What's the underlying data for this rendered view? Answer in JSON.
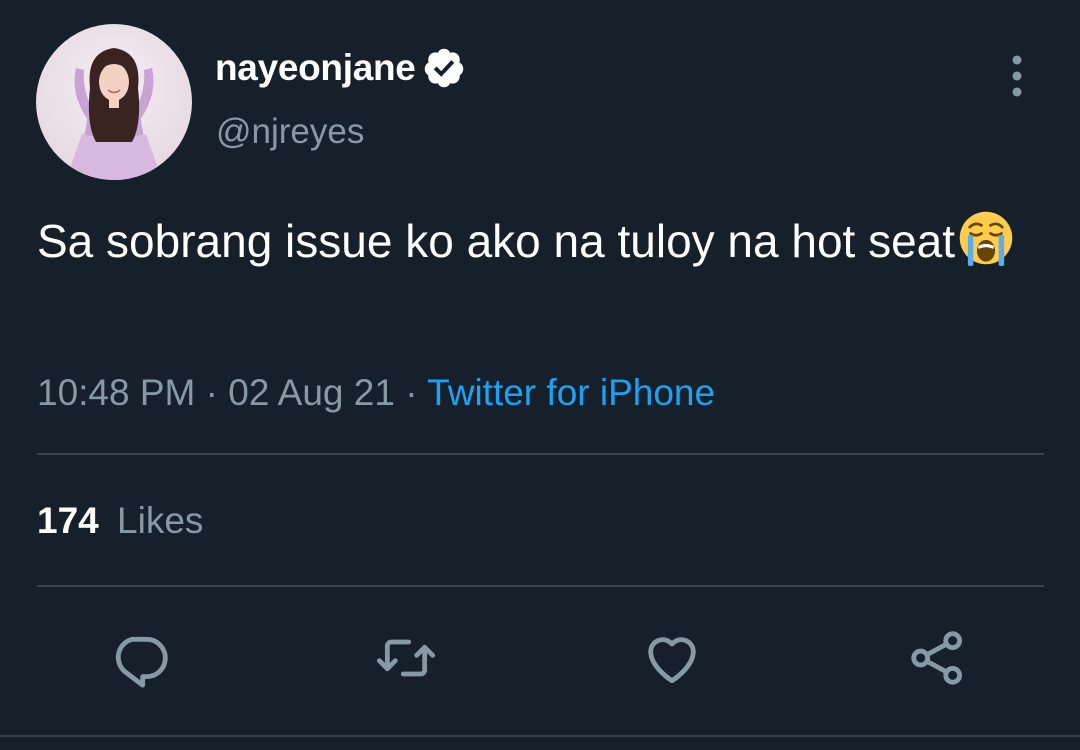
{
  "tweet": {
    "display_name": "nayeonjane",
    "handle": "@njreyes",
    "text": "Sa sobrang issue ko ako na tuloy na hot seat",
    "emoji": "loudly-crying-face",
    "time": "10:48 PM",
    "date": "02 Aug 21",
    "separator": "·",
    "source": "Twitter for iPhone",
    "likes_count": "174",
    "likes_label": "Likes",
    "verified": true
  },
  "icons": {
    "verified": "verified-badge-icon",
    "more": "more-vertical-icon",
    "reply": "reply-icon",
    "retweet": "retweet-icon",
    "like": "like-heart-icon",
    "share": "share-icon"
  },
  "colors": {
    "background": "#15202b",
    "primary_text": "#ffffff",
    "secondary_text": "#8899a6",
    "accent": "#1da1f2",
    "divider": "#38444d"
  }
}
